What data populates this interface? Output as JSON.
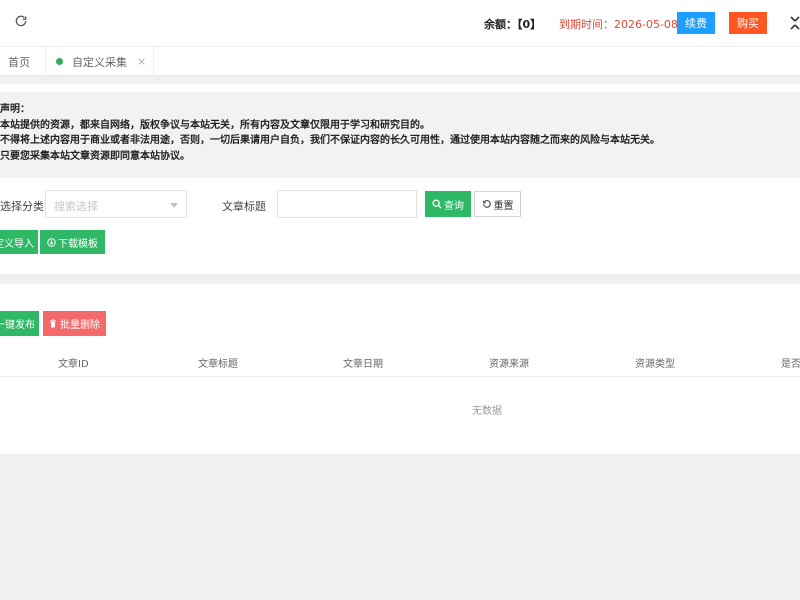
{
  "header": {
    "balance_label": "余额：",
    "balance_value": "【0】",
    "expire_label": "到期时间：",
    "expire_value": "2026-05-08",
    "renew_label": "续费",
    "buy_label": "购买",
    "colors": {
      "renew": "#1e9fff",
      "buy": "#ff5722",
      "expire_text": "#e04a3a"
    }
  },
  "tabs": [
    {
      "label": "首页"
    },
    {
      "label": "自定义采集",
      "close": "×",
      "dot_color": "#3aaa5c"
    }
  ],
  "notice": {
    "title": "声明：",
    "lines": [
      "本站提供的资源，都来自网络，版权争议与本站无关，所有内容及文章仅限用于学习和研究目的。",
      "不得将上述内容用于商业或者非法用途，否则，一切后果请用户自负，我们不保证内容的长久可用性，通过使用本站内容随之而来的风险与本站无关。",
      "只要您采集本站文章资源即同意本站协议。"
    ]
  },
  "filters": {
    "category_label": "选择分类",
    "category_placeholder": "搜索选择",
    "title_label": "文章标题",
    "title_value": "",
    "query_label": "查询",
    "reset_label": "重置"
  },
  "actions": {
    "import_label": "定义导入",
    "template_label": "下载模板",
    "publish_label": "一键发布",
    "batch_delete_label": "批量删除"
  },
  "table": {
    "columns": [
      "文章ID",
      "文章标题",
      "文章日期",
      "资源来源",
      "资源类型",
      "是否"
    ],
    "empty_text": "无数据"
  },
  "colors": {
    "primary": "#2fb866",
    "danger": "#f46a6a"
  }
}
